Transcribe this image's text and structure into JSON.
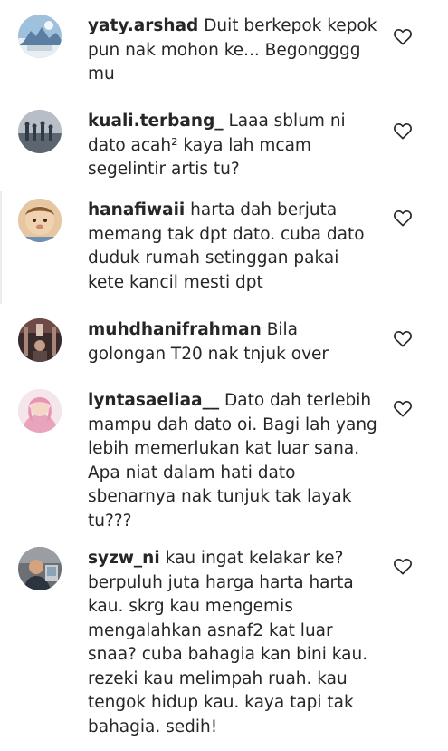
{
  "comments": [
    {
      "username": "yaty.arshad",
      "text": "Duit berkepok kepok pun nak mohon ke... Begongggg mu",
      "avatar": "avatar-yaty-arshad"
    },
    {
      "username": "kuali.terbang_",
      "text": "Laaa sblum ni dato acah² kaya lah mcam segelintir artis tu?",
      "avatar": "avatar-kuali-terbang"
    },
    {
      "username": "hanafiwaii",
      "text": "harta dah berjuta memang tak dpt dato. cuba dato duduk rumah setinggan pakai kete kancil mesti dpt",
      "avatar": "avatar-hanafiwaii"
    },
    {
      "username": "muhdhanifrahman",
      "text": "Bila golongan T20 nak tnjuk over",
      "avatar": "avatar-muhdhanifrahman"
    },
    {
      "username": "lyntasaeliaa__",
      "text": "Dato dah terlebih mampu dah dato oi. Bagi lah yang lebih memerlukan kat luar sana. Apa niat dalam hati dato sbenarnya nak tunjuk tak layak tu???",
      "avatar": "avatar-lyntasaeliaa"
    },
    {
      "username": "syzw_ni",
      "text": "kau ingat kelakar ke? berpuluh juta harga harta harta kau. skrg kau mengemis mengalahkan asnaf2 kat luar snaa? cuba bahagia kan bini kau. rezeki kau melimpah ruah. kau tengok hidup kau. kaya tapi tak bahagia. sedih!",
      "avatar": "avatar-syzw-ni"
    }
  ],
  "icons": {
    "like": "heart-outline-icon"
  },
  "colors": {
    "text": "#262626",
    "heart": "#262626",
    "background": "#ffffff"
  }
}
